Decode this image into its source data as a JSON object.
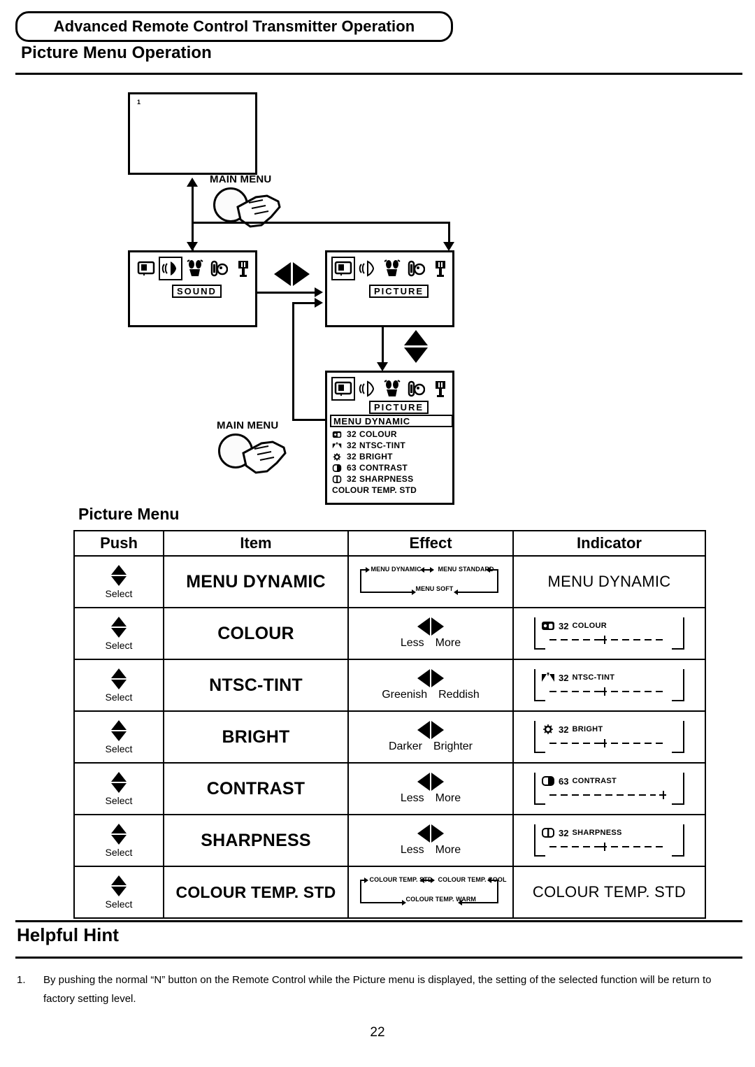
{
  "header": {
    "banner_title": "Advanced Remote Control Transmitter Operation",
    "section_title": "Picture Menu Operation"
  },
  "diagram": {
    "top_screen_mark": "1",
    "main_menu_label_upper": "MAIN MENU",
    "main_menu_label_lower": "MAIN MENU",
    "sound_screen": {
      "tag": "SOUND",
      "icons": [
        "picture-icon",
        "sound-icon",
        "feature-icon",
        "setup-icon",
        "timer-icon"
      ],
      "selected_icon_index": 1
    },
    "picture_screen": {
      "tag": "PICTURE",
      "icons": [
        "picture-icon",
        "sound-icon",
        "feature-icon",
        "setup-icon",
        "timer-icon"
      ],
      "selected_icon_index": 0
    },
    "picture_menu_screen": {
      "tag": "PICTURE",
      "highlighted_row": "MENU  DYNAMIC",
      "rows": [
        {
          "icon": "colour-icon",
          "value": "32",
          "label": "COLOUR"
        },
        {
          "icon": "tint-icon",
          "value": "32",
          "label": "NTSC-TINT"
        },
        {
          "icon": "bright-icon",
          "value": "32",
          "label": "BRIGHT"
        },
        {
          "icon": "contrast-icon",
          "value": "63",
          "label": "CONTRAST"
        },
        {
          "icon": "sharpness-icon",
          "value": "32",
          "label": "SHARPNESS"
        }
      ],
      "footer_row": "COLOUR TEMP. STD"
    }
  },
  "table": {
    "caption": "Picture Menu",
    "columns": [
      "Push",
      "Item",
      "Effect",
      "Indicator"
    ],
    "push_select_label": "Select",
    "rows": [
      {
        "item": "MENU DYNAMIC",
        "effect_type": "cycle",
        "effect_cycle": [
          "MENU DYNAMIC",
          "MENU STANDARD",
          "MENU SOFT"
        ],
        "indicator_type": "text",
        "indicator_text": "MENU DYNAMIC"
      },
      {
        "item": "COLOUR",
        "effect_type": "leftright",
        "effect_left": "Less",
        "effect_right": "More",
        "indicator_type": "bar",
        "indicator_icon": "colour-icon",
        "indicator_value": "32",
        "indicator_name": "COLOUR",
        "indicator_marker_pct": 50
      },
      {
        "item": "NTSC-TINT",
        "effect_type": "leftright",
        "effect_left": "Greenish",
        "effect_right": "Reddish",
        "indicator_type": "bar",
        "indicator_icon": "tint-icon",
        "indicator_value": "32",
        "indicator_name": "NTSC-TINT",
        "indicator_marker_pct": 50
      },
      {
        "item": "BRIGHT",
        "effect_type": "leftright",
        "effect_left": "Darker",
        "effect_right": "Brighter",
        "indicator_type": "bar",
        "indicator_icon": "bright-icon",
        "indicator_value": "32",
        "indicator_name": "BRIGHT",
        "indicator_marker_pct": 50
      },
      {
        "item": "CONTRAST",
        "effect_type": "leftright",
        "effect_left": "Less",
        "effect_right": "More",
        "indicator_type": "bar",
        "indicator_icon": "contrast-icon",
        "indicator_value": "63",
        "indicator_name": "CONTRAST",
        "indicator_marker_pct": 100
      },
      {
        "item": "SHARPNESS",
        "effect_type": "leftright",
        "effect_left": "Less",
        "effect_right": "More",
        "indicator_type": "bar",
        "indicator_icon": "sharpness-icon",
        "indicator_value": "32",
        "indicator_name": "SHARPNESS",
        "indicator_marker_pct": 50
      },
      {
        "item": "COLOUR TEMP. STD",
        "effect_type": "cycle",
        "effect_cycle": [
          "COLOUR TEMP. STD",
          "COLOUR TEMP. COOL",
          "COLOUR TEMP. WARM"
        ],
        "indicator_type": "text",
        "indicator_text": "COLOUR TEMP. STD"
      }
    ]
  },
  "helpful_hint": {
    "title": "Helpful Hint",
    "items": [
      {
        "number": "1.",
        "text": "By pushing the normal “N” button on the Remote Control while the Picture menu is displayed, the setting of the selected function will be return to factory setting level."
      }
    ]
  },
  "page_number": "22"
}
